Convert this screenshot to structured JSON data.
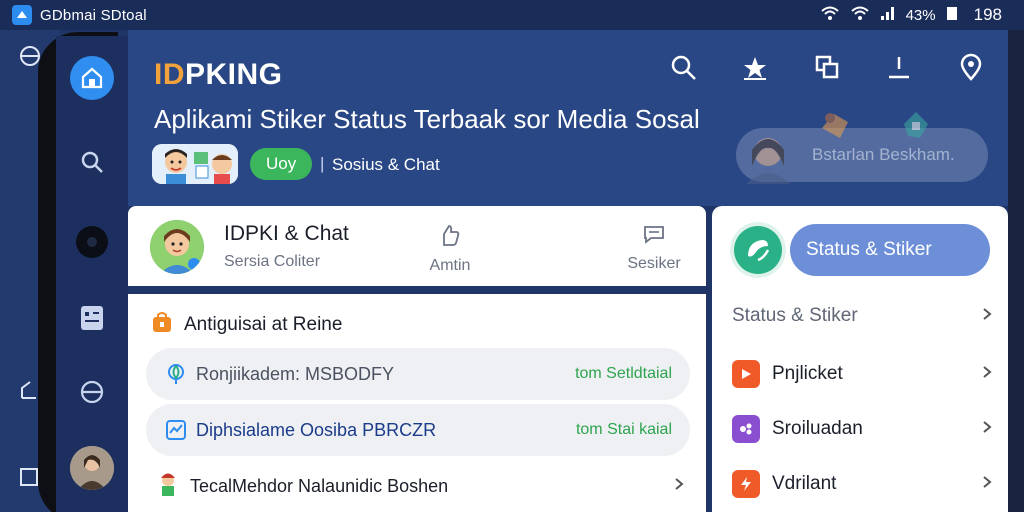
{
  "status_bar": {
    "title": "GDbmai SDtoal",
    "battery": "43%",
    "time": "198"
  },
  "header": {
    "brand_part1": "ID",
    "brand_part2": "PKING",
    "tagline": "Aplikami Stiker Status Terbaak sor Media Sosal",
    "pill_label": "Uoy",
    "separator": "|",
    "meta_text": "Sosius & Chat",
    "promo_label": "Bstarlan Beskham."
  },
  "profile": {
    "name": "IDPKI & Chat",
    "subtitle": "Sersia Coliter",
    "action1_label": "Amtin",
    "action2_label": "Sesiker"
  },
  "list": {
    "section_title": "Antiguisai at Reine",
    "rows": [
      {
        "title": "Ronjiikadem: MSBODFY",
        "action": "tom Setldtaial"
      },
      {
        "title": "Diphsialame Oosiba PBRCZR",
        "action": "tom Stai kaial"
      }
    ],
    "plain_row": "TecalMehdor Nalaunidic Boshen"
  },
  "right_panel": {
    "cta_label": "Status & Stiker",
    "header_row": "Status & Stiker",
    "items": [
      {
        "label": "Pnjlicket",
        "color": "#f05a28"
      },
      {
        "label": "Sroiluadan",
        "color": "#8a4fd1"
      },
      {
        "label": "Vdrilant",
        "color": "#f05a28"
      }
    ]
  },
  "colors": {
    "header_bg": "#2a4785",
    "brand_orange": "#f2a23a",
    "accent_green": "#3cb65d",
    "accent_blue": "#6d8fd8"
  }
}
